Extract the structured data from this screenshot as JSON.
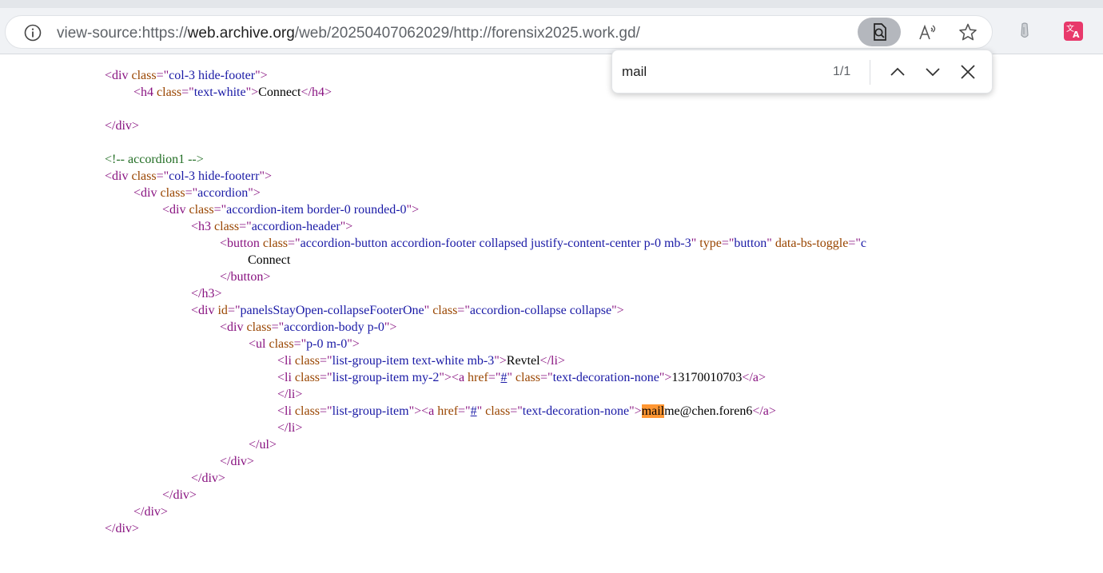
{
  "address_bar": {
    "url_prefix": "view-source:https://",
    "url_domain": "web.archive.org",
    "url_suffix": "/web/20250407062029/http://forensix2025.work.gd/"
  },
  "toolbar_icons": [
    "info-icon",
    "find-on-page-icon",
    "read-aloud-icon",
    "favorite-star-icon",
    "extension-icon",
    "translate-icon"
  ],
  "find_bar": {
    "query": "mail",
    "count": "1/1"
  },
  "source": {
    "l01": {
      "tag": "div",
      "attr": "class",
      "value": "col-3 hide-footer"
    },
    "l02": {
      "tag": "h4",
      "attr": "class",
      "value": "text-white",
      "text": "Connect",
      "close": "h4"
    },
    "l04": {
      "close": "div"
    },
    "l06": {
      "comment": "<!-- accordion1 -->"
    },
    "l07": {
      "tag": "div",
      "attr": "class",
      "value": "col-3 hide-footerr"
    },
    "l08": {
      "tag": "div",
      "attr": "class",
      "value": "accordion"
    },
    "l09": {
      "tag": "div",
      "attr": "class",
      "value": "accordion-item border-0 rounded-0"
    },
    "l10": {
      "tag": "h3",
      "attr": "class",
      "value": "accordion-header"
    },
    "l11": {
      "tag": "button",
      "attr": "class",
      "value": "accordion-button accordion-footer collapsed justify-content-center p-0 mb-3",
      "attr2": "type",
      "value2": "button",
      "attr3": "data-bs-toggle",
      "value3_partial": "c"
    },
    "l12": {
      "text": "Connect"
    },
    "l13": {
      "close": "button"
    },
    "l14": {
      "close": "h3"
    },
    "l15": {
      "tag": "div",
      "attr": "id",
      "value": "panelsStayOpen-collapseFooterOne",
      "attr2": "class",
      "value2": "accordion-collapse collapse"
    },
    "l16": {
      "tag": "div",
      "attr": "class",
      "value": "accordion-body p-0"
    },
    "l17": {
      "tag": "ul",
      "attr": "class",
      "value": "p-0 m-0"
    },
    "l18": {
      "tag": "li",
      "attr": "class",
      "value": "list-group-item text-white mb-3",
      "text": "Revtel",
      "close": "li"
    },
    "l19": {
      "tag": "li",
      "attr": "class",
      "value": "list-group-item my-2",
      "tag2": "a",
      "attr2": "href",
      "value2": "#",
      "attr3": "class",
      "value3": "text-decoration-none",
      "text": "13170010703",
      "close": "a"
    },
    "l20": {
      "close": "li"
    },
    "l21": {
      "tag": "li",
      "attr": "class",
      "value": "list-group-item",
      "tag2": "a",
      "attr2": "href",
      "value2": "#",
      "attr3": "class",
      "value3": "text-decoration-none",
      "text_match": "mail",
      "text_rest": "me@chen.foren6",
      "close": "a"
    },
    "l22": {
      "close": "li"
    },
    "l23": {
      "close": "ul"
    },
    "l24": {
      "close": "div"
    },
    "l25": {
      "close": "div"
    },
    "l26": {
      "close": "div"
    },
    "l27": {
      "close": "div"
    },
    "l28": {
      "close": "div"
    }
  }
}
